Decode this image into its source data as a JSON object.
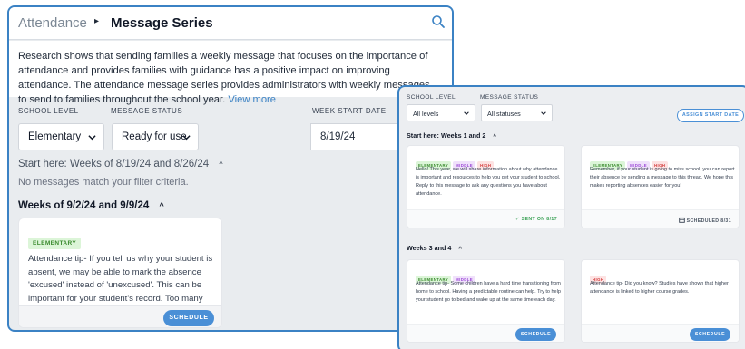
{
  "back_window": {
    "breadcrumb": {
      "parent": "Attendance",
      "separator": "▸",
      "current": "Message Series"
    },
    "intro": {
      "text": "Research shows that sending families a weekly message that focuses on the importance of attendance and provides families with guidance has a positive impact on improving attendance. The attendance message series provides administrators with weekly messages to send to families throughout the school year.",
      "view_more": "View more"
    },
    "filters": {
      "school_level_label": "SCHOOL LEVEL",
      "school_level_value": "Elementary",
      "status_label": "MESSAGE STATUS",
      "status_value": "Ready for use",
      "week_label": "WEEK START DATE",
      "week_value": "8/19/24"
    },
    "start_section": {
      "label": "Start here: Weeks of 8/19/24 and 8/26/24",
      "empty": "No messages match your filter criteria."
    },
    "weeks_section": {
      "label": "Weeks of 9/2/24 and 9/9/24"
    },
    "card": {
      "tag": "ELEMENTARY",
      "text": "Attendance tip- If you tell us why your student is absent, we may be able to mark the absence 'excused' instead of 'unexcused'. This can be important for your student's record. Too many 'unexcused' absences can result in truancy. The next time your student is absent, send us a",
      "button": "SCHEDULE"
    }
  },
  "front_window": {
    "filters": {
      "school_level_label": "SCHOOL LEVEL",
      "school_level_value": "All levels",
      "status_label": "MESSAGE STATUS",
      "status_value": "All statuses",
      "assign_button": "ASSIGN START DATE"
    },
    "section1": "Start here: Weeks 1 and 2",
    "section2": "Weeks 3 and 4",
    "cards": [
      {
        "tags": [
          "ELEMENTARY",
          "MIDDLE",
          "HIGH"
        ],
        "text": "Hello! This year, we will share information about why attendance is important and resources to help you get your student to school. Reply to this message to ask any questions you have about attendance.",
        "status": "SENT ON 8/17"
      },
      {
        "tags": [
          "ELEMENTARY",
          "MIDDLE",
          "HIGH"
        ],
        "text": "Remember, if your student is going to miss school, you can report their absence by sending a message to this thread. We hope this makes reporting absences easier for you!",
        "status": "SCHEDULED 8/31"
      },
      {
        "tags": [
          "ELEMENTARY",
          "MIDDLE"
        ],
        "text": "Attendance tip- Some children have a hard time transitioning from home to school. Having a predictable routine can help. Try to help your student go to bed and wake up at the same time each day.",
        "button": "SCHEDULE"
      },
      {
        "tags": [
          "HIGH"
        ],
        "text": "Attendance tip- Did you know? Studies have shown that higher attendance is linked to higher course grades.",
        "button": "SCHEDULE"
      }
    ]
  },
  "colors": {
    "accent": "#3b82c4",
    "button": "#4a8fd6",
    "sent": "#3aa155"
  }
}
